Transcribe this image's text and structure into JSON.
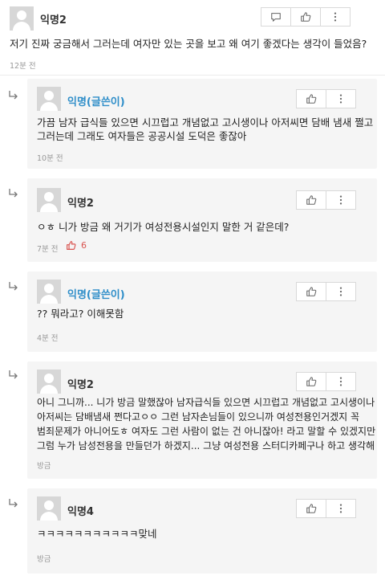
{
  "main": {
    "author": "익명2",
    "text": "저기 진짜 궁금해서 그러는데 여자만 있는 곳을 보고 왜 여기 좋겠다는 생각이 들었음?",
    "time": "12분 전"
  },
  "replies": [
    {
      "author": "익명(글쓴이)",
      "text": "가끔 남자 급식들 있으면 시끄럽고 개념없고 고시생이나 아저씨면 담배 냄새 쩔고\n그러는데 그래도 여자들은 공공시설 도덕은 좋잖아",
      "time": "10분 전"
    },
    {
      "author": "익명2",
      "text": "ㅇㅎ 니가 방금 왜 거기가 여성전용시설인지 말한 거 같은데?",
      "time": "7분 전",
      "likes": "6"
    },
    {
      "author": "익명(글쓴이)",
      "text": "?? 뭐라고? 이해못함",
      "time": "4분 전"
    },
    {
      "author": "익명2",
      "text": "아니 그니까... 니가 방금 말했잖아 남자급식들 있으면 시끄럽고 개념없고 고시생이나\n아저씨는 담배냄새 쩐다고ㅇㅇ 그런 남자손님들이 있으니까 여성전용인거겠지 꼭\n범죄문제가 아니어도ㅎ 여자도 그런 사람이 없는 건 아니잖아! 라고 말할 수 있겠지만\n그럼 누가 남성전용을 만들던가 하겠지... 그냥 여성전용 스터디카페구나 하고 생각해",
      "time": "방금"
    },
    {
      "author": "익명4",
      "text": "ㅋㅋㅋㅋㅋㅋㅋㅋㅋㅋㅋ맞네",
      "time": "방금"
    }
  ],
  "icons": {
    "comment": "speech-bubble-icon",
    "like": "thumbs-up-icon",
    "more": "kebab-menu-icon",
    "reply": "reply-arrow-icon"
  }
}
